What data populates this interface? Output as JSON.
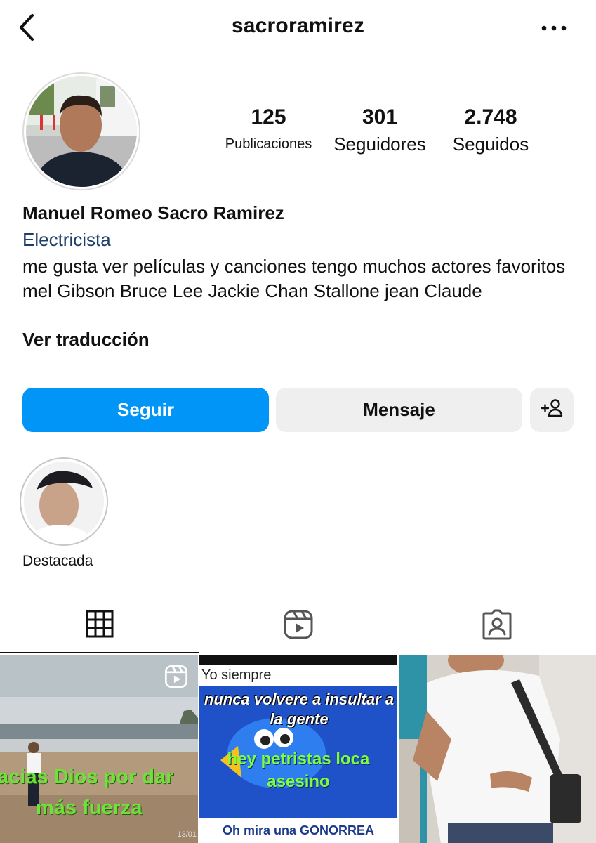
{
  "header": {
    "username": "sacroramirez",
    "back_icon": "chevron-left-icon",
    "more_icon": "more-horizontal-icon"
  },
  "profile": {
    "avatar_icon": "avatar",
    "stats": {
      "posts": {
        "value": "125",
        "label": "Publicaciones"
      },
      "followers": {
        "value": "301",
        "label": "Seguidores"
      },
      "following": {
        "value": "2.748",
        "label": "Seguidos"
      }
    },
    "full_name": "Manuel Romeo Sacro Ramirez",
    "category": "Electricista",
    "bio": "me gusta ver películas y canciones tengo muchos actores favoritos mel Gibson Bruce Lee Jackie Chan Stallone jean Claude",
    "translate_label": "Ver traducción"
  },
  "actions": {
    "follow_label": "Seguir",
    "message_label": "Mensaje",
    "add_user_icon": "add-user-icon"
  },
  "highlights": [
    {
      "label": "Destacada"
    }
  ],
  "tabs": [
    {
      "icon": "grid-icon",
      "active": true
    },
    {
      "icon": "reels-icon",
      "active": false
    },
    {
      "icon": "tagged-icon",
      "active": false
    }
  ],
  "posts": [
    {
      "type": "reel",
      "overlay_line1": "acias Dios por dar",
      "overlay_line2": "más fuerza",
      "date": "13/01"
    },
    {
      "type": "image",
      "top_text": "Yo siempre",
      "title": "nunca volvere a insultar a la gente",
      "middle": "hey petristas loca asesino",
      "bottom": "Oh mira una GONORREA"
    },
    {
      "type": "image"
    }
  ],
  "colors": {
    "accent": "#0095f6",
    "category": "#1d3d6b",
    "button_bg": "#efefef"
  }
}
